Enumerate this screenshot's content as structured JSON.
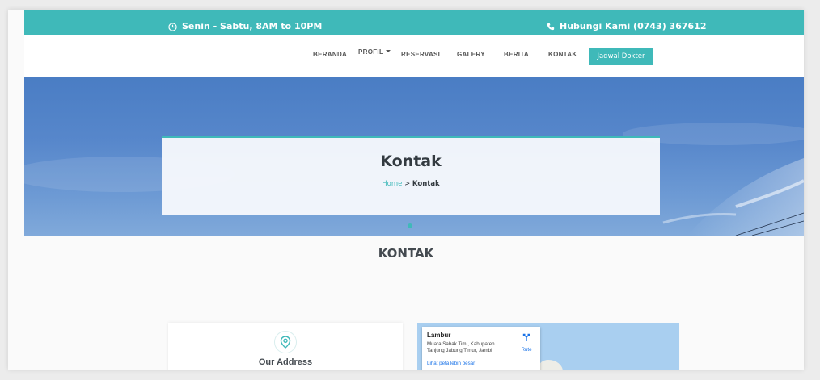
{
  "topbar": {
    "hours": "Senin - Sabtu, 8AM to 10PM",
    "phone": "Hubungi Kami (0743) 367612",
    "clock_icon": "clock-icon",
    "phone_icon": "phone-icon"
  },
  "nav": {
    "items": [
      {
        "label": "BERANDA"
      },
      {
        "label": "PROFIL"
      },
      {
        "label": "RESERVASI"
      },
      {
        "label": "GALERY"
      },
      {
        "label": "BERITA"
      },
      {
        "label": "KONTAK"
      }
    ],
    "cta_label": "Jadwal Dokter"
  },
  "hero": {
    "title": "Kontak",
    "breadcrumb_home": "Home",
    "breadcrumb_sep": " > ",
    "breadcrumb_current": "Kontak"
  },
  "section": {
    "title": "KONTAK"
  },
  "address_card": {
    "title": "Our Address",
    "icon": "map-pin-icon"
  },
  "map": {
    "place_name": "Lambur",
    "place_address": "Muara Sabak Tim., Kabupaten Tanjung Jabung Timur, Jambi",
    "route_label": "Rute",
    "larger_map_link": "Lihat peta lebih besar"
  },
  "colors": {
    "accent": "#3fb9b9",
    "sky": "#5787cb",
    "text_dark": "#333a40"
  }
}
